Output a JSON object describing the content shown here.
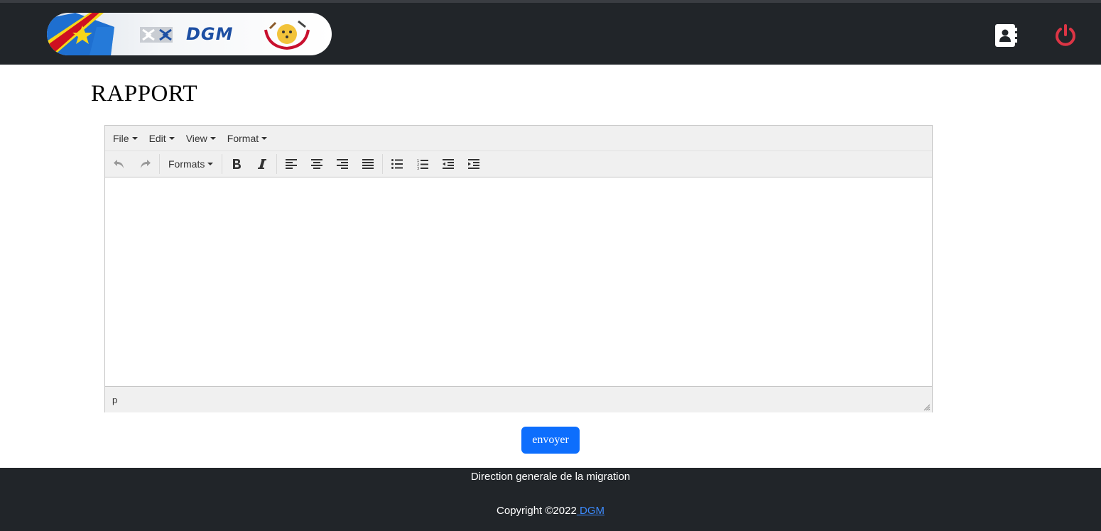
{
  "header": {
    "logo": {
      "text": "DGM",
      "icon": "dgm-logo"
    },
    "actions": [
      {
        "icon": "address-book-icon"
      },
      {
        "icon": "power-icon",
        "color": "#dc3545"
      }
    ]
  },
  "page": {
    "title": "RAPPORT"
  },
  "editor": {
    "menu": [
      {
        "label": "File"
      },
      {
        "label": "Edit"
      },
      {
        "label": "View"
      },
      {
        "label": "Format"
      }
    ],
    "toolbar": {
      "formats_label": "Formats",
      "buttons": [
        "undo-icon",
        "redo-icon",
        "bold-icon",
        "italic-icon",
        "align-left-icon",
        "align-center-icon",
        "align-right-icon",
        "align-justify-icon",
        "bullet-list-icon",
        "numbered-list-icon",
        "outdent-icon",
        "indent-icon"
      ]
    },
    "content": "",
    "status_path": "p"
  },
  "form": {
    "submit_label": "envoyer",
    "submit_color": "#0d6efd"
  },
  "footer": {
    "line1": "Direction generale de la migration",
    "copyright_prefix": "Copyright ©2022",
    "link_text": " DGM"
  },
  "colors": {
    "navbar_bg": "#212529",
    "accent": "#0d6efd",
    "link": "#3d8bfd"
  }
}
